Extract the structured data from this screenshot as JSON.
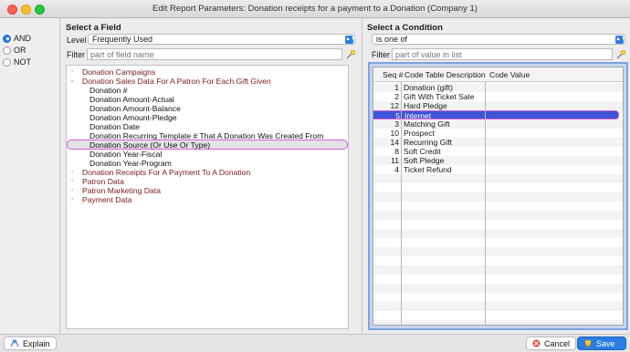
{
  "window": {
    "title": "Edit Report Parameters: Donation receipts for a payment to a Donation (Company 1)"
  },
  "logic": {
    "options": [
      "AND",
      "OR",
      "NOT"
    ],
    "selected": "AND"
  },
  "field_panel": {
    "heading": "Select a Field",
    "level_label": "Level",
    "level_value": "Frequently Used",
    "filter_label": "Filter",
    "filter_placeholder": "part of field name",
    "tree": [
      {
        "label": "Donation Campaigns",
        "type": "group",
        "expanded": false
      },
      {
        "label": "Donation Sales Data For A Patron For Each Gift Given",
        "type": "group",
        "expanded": true
      },
      {
        "label": "Donation #",
        "type": "leaf"
      },
      {
        "label": "Donation Amount-Actual",
        "type": "leaf"
      },
      {
        "label": "Donation Amount-Balance",
        "type": "leaf"
      },
      {
        "label": "Donation Amount-Pledge",
        "type": "leaf"
      },
      {
        "label": "Donation Date",
        "type": "leaf"
      },
      {
        "label": "Donation Recurring Template # That A Donation Was Created From",
        "type": "leaf"
      },
      {
        "label": "Donation Source (Or Use Or Type)",
        "type": "leaf",
        "selected": true
      },
      {
        "label": "Donation Year-Fiscal",
        "type": "leaf"
      },
      {
        "label": "Donation Year-Program",
        "type": "leaf"
      },
      {
        "label": "Donation Receipts For A Payment To A Donation",
        "type": "group",
        "expanded": false
      },
      {
        "label": "Patron Data",
        "type": "group",
        "expanded": false
      },
      {
        "label": "Patron Marketing Data",
        "type": "group",
        "expanded": false
      },
      {
        "label": "Payment Data",
        "type": "group",
        "expanded": false
      }
    ]
  },
  "condition_panel": {
    "heading": "Select a Condition",
    "condition_value": "is one of",
    "filter_label": "Filter",
    "filter_placeholder": "part of value in list",
    "columns": [
      "Seq #",
      "Code Table Description",
      "Code Value"
    ],
    "rows": [
      {
        "seq": "1",
        "desc": "Donation (gift)"
      },
      {
        "seq": "2",
        "desc": "Gift With Ticket Sale"
      },
      {
        "seq": "12",
        "desc": "Hard Pledge"
      },
      {
        "seq": "5",
        "desc": "Internet",
        "selected": true
      },
      {
        "seq": "3",
        "desc": "Matching Gift"
      },
      {
        "seq": "10",
        "desc": "Prospect"
      },
      {
        "seq": "14",
        "desc": "Recurring Gift"
      },
      {
        "seq": "8",
        "desc": "Soft Credit"
      },
      {
        "seq": "11",
        "desc": "Soft Pledge"
      },
      {
        "seq": "4",
        "desc": "Ticket Refund"
      }
    ]
  },
  "footer": {
    "explain_label": "Explain",
    "cancel_label": "Cancel",
    "save_label": "Save"
  },
  "colors": {
    "accent": "#2a7de1",
    "selection": "#3d54d6",
    "highlight_outline": "#d25ed2",
    "group_text": "#7a1a1a"
  }
}
